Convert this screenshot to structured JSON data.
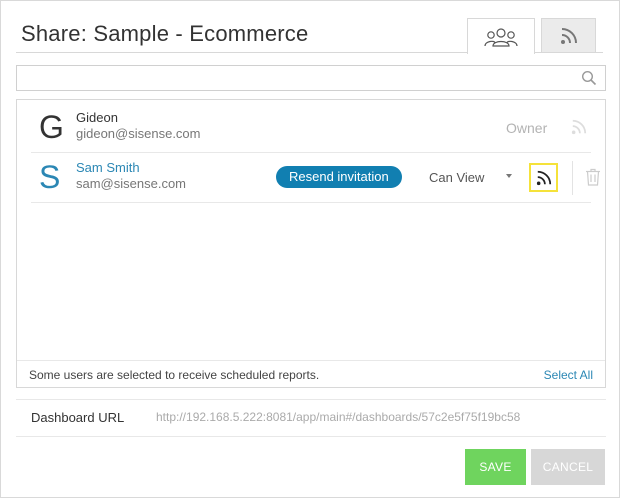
{
  "dialog": {
    "title": "Share: Sample - Ecommerce",
    "tabs": [
      {
        "icon": "users-icon",
        "active": true
      },
      {
        "icon": "rss-icon",
        "active": false
      }
    ]
  },
  "search": {
    "value": "",
    "placeholder": ""
  },
  "users": [
    {
      "initial": "G",
      "name": "Gideon",
      "email": "gideon@sisense.com",
      "role": "Owner"
    },
    {
      "initial": "S",
      "name": "Sam Smith",
      "email": "sam@sisense.com",
      "resend_label": "Resend invitation",
      "permission": "Can View"
    }
  ],
  "footer": {
    "note": "Some users are selected to receive scheduled reports.",
    "select_all": "Select All"
  },
  "dashboard_url": {
    "label": "Dashboard URL",
    "value": "http://192.168.5.222:8081/app/main#/dashboards/57c2e5f75f19bc58"
  },
  "actions": {
    "save": "SAVE",
    "cancel": "CANCEL"
  },
  "colors": {
    "accent": "#117fb1",
    "link": "#2b87b4",
    "save": "#6fd45e",
    "cancel": "#d7d7d7",
    "highlight": "#f5e23a"
  }
}
